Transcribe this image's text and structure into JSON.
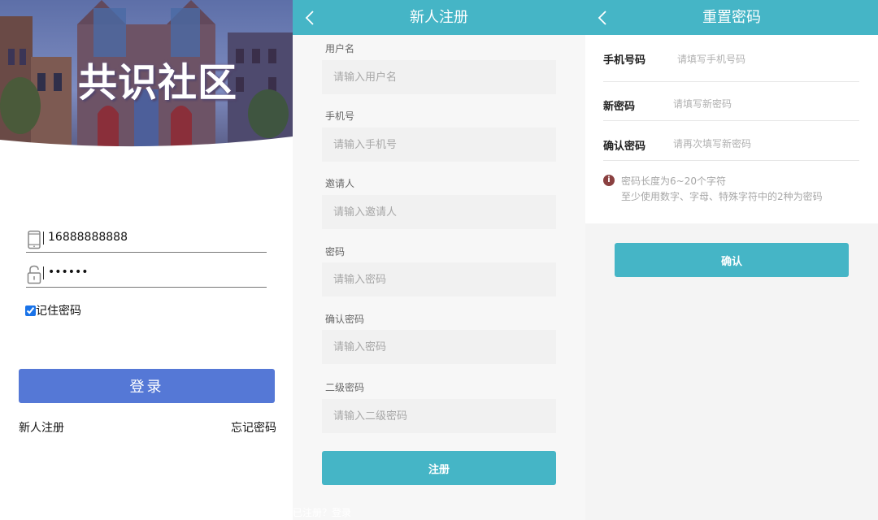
{
  "colors": {
    "accent_teal": "#45b5c6",
    "login_blue": "#5578d6",
    "warning_icon": "#8a4040"
  },
  "login": {
    "brand_title": "共识社区",
    "phone_value": "16888888888",
    "password_value": "888888",
    "remember_label": "记住密码",
    "login_button": "登录",
    "register_link": "新人注册",
    "forgot_link": "忘记密码",
    "phone_icon": "phone-icon",
    "lock_icon": "lock-icon"
  },
  "register": {
    "title": "新人注册",
    "fields": [
      {
        "label": "用户名",
        "placeholder": "请输入用户名"
      },
      {
        "label": "手机号",
        "placeholder": "请输入手机号"
      },
      {
        "label": "邀请人",
        "placeholder": "请输入邀请人"
      },
      {
        "label": "密码",
        "placeholder": "请输入密码"
      },
      {
        "label": "确认密码",
        "placeholder": "请输入密码"
      },
      {
        "label": "二级密码",
        "placeholder": "请输入二级密码"
      }
    ],
    "submit_button": "注册",
    "footer_text": "已注册？登录"
  },
  "reset": {
    "title": "重置密码",
    "rows": [
      {
        "label": "手机号码",
        "placeholder": "请填写手机号码"
      },
      {
        "label": "新密码",
        "placeholder": "请填写新密码"
      },
      {
        "label": "确认密码",
        "placeholder": "请再次填写新密码"
      }
    ],
    "hint_line1": "密码长度为6~20个字符",
    "hint_line2": "至少使用数字、字母、特殊字符中的2种为密码",
    "hint_icon": "i",
    "confirm_button": "确认"
  }
}
